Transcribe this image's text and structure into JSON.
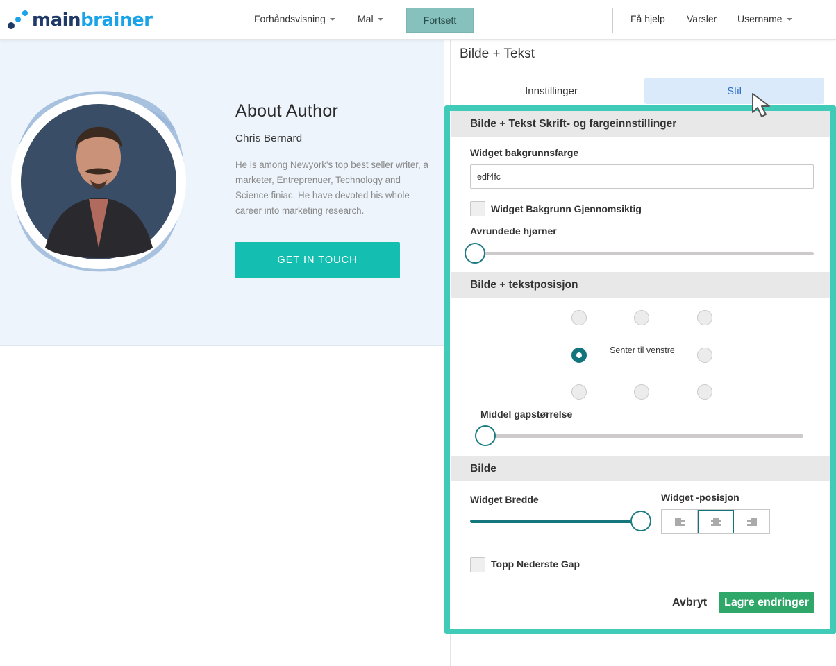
{
  "header": {
    "logo": {
      "part1": "main",
      "part2": "brainer"
    },
    "nav": [
      {
        "label": "Forhåndsvisning"
      },
      {
        "label": "Mal"
      }
    ],
    "continue_label": "Fortsett",
    "help_label": "Få hjelp",
    "alerts_label": "Varsler",
    "user_label": "Username"
  },
  "preview": {
    "title": "About Author",
    "name": "Chris Bernard",
    "description": "He is among Newyork's top best seller writer, a marketer, Entreprenuer, Technology and Science finiac. He have devoted his whole career into marketing research.",
    "cta_label": "GET IN TOUCH",
    "background": "#edf4fc",
    "cta_color": "#14bfb1"
  },
  "panel": {
    "title": "Bilde + Tekst",
    "tabs": [
      {
        "label": "Innstillinger",
        "active": false
      },
      {
        "label": "Stil",
        "active": true
      }
    ],
    "sections": {
      "font_color": {
        "heading": "Bilde + Tekst Skrift- og fargeinnstillinger",
        "bg_color_label": "Widget bakgrunnsfarge",
        "bg_color_value": "edf4fc",
        "transparent_label": "Widget Bakgrunn Gjennomsiktig",
        "transparent_checked": false,
        "rounded_label": "Avrundede hjørner",
        "rounded_value": 0
      },
      "position": {
        "heading": "Bilde + tekstposisjon",
        "selected_label": "Senter til venstre",
        "selected": "middle-left",
        "gap_label": "Middel gapstørrelse",
        "gap_value": 0
      },
      "image": {
        "heading": "Bilde",
        "width_label": "Widget Bredde",
        "width_value": 1.0,
        "position_label": "Widget -posisjon",
        "position_selected": "center",
        "position_options": [
          "left",
          "center",
          "right"
        ],
        "gap_label": "Topp Nederste Gap",
        "gap_checked": false
      }
    },
    "cancel_label": "Avbryt",
    "save_label": "Lagre endringer"
  },
  "colors": {
    "accent": "#13757c",
    "highlight_frame": "#3fcbb7",
    "save": "#2fa768",
    "tab_active_bg": "#dbeafb"
  }
}
